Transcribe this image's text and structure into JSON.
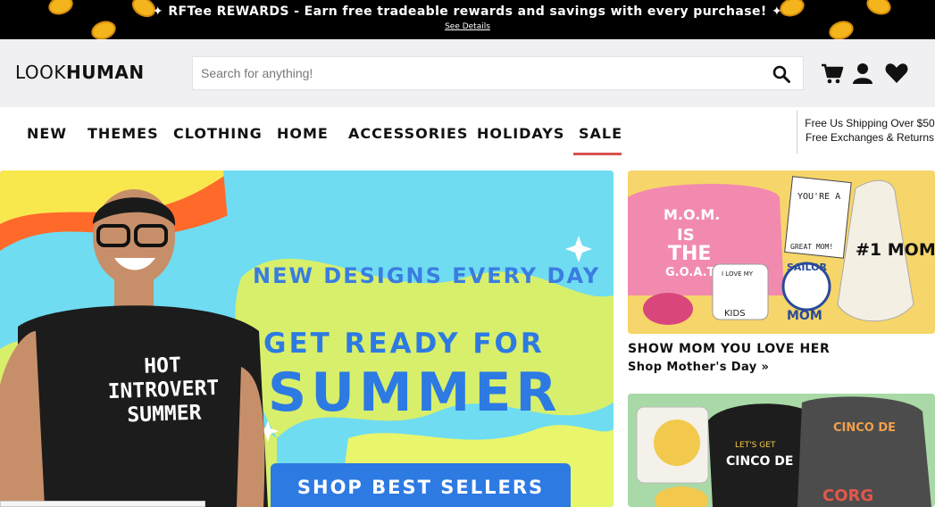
{
  "rewards": {
    "prefix": "✦ ",
    "brand": "RFTee REWARDS",
    "text": " - Earn free tradeable rewards and savings with every purchase! ✦",
    "link": "See Details"
  },
  "header": {
    "logo_light": "LOOK",
    "logo_bold": "HUMAN",
    "search_placeholder": "Search for anything!",
    "icons": [
      "search-icon",
      "cart-icon",
      "account-icon",
      "wishlist-heart-icon"
    ]
  },
  "nav": {
    "items": [
      "NEW",
      "THEMES",
      "CLOTHING",
      "HOME",
      "ACCESSORIES",
      "HOLIDAYS",
      "SALE"
    ],
    "active": "SALE",
    "shipping_line1": "Free Us Shipping Over $50",
    "shipping_line2": "Free Exchanges & Returns"
  },
  "hero": {
    "headline1": "NEW DESIGNS EVERY DAY",
    "headline2": "GET READY FOR",
    "headline3": "SUMMER",
    "cta": "SHOP BEST SELLERS",
    "shirt_lines": [
      "HOT",
      "INTROVERT",
      "SUMMER"
    ]
  },
  "promos": [
    {
      "title": "SHOW MOM YOU LOVE HER",
      "link": "Shop Mother's Day »",
      "art_text": [
        "M.O.M.",
        "IS",
        "THE",
        "G.O.A.T.",
        "YOU'RE A",
        "GREAT MOM!",
        "#1 MOM",
        "SAILOR",
        "MOM",
        "I LOVE MY",
        "KIDS"
      ]
    },
    {
      "art_text": [
        "CINCO DE",
        "CORG",
        "LET'S GET",
        "CINCO DE"
      ]
    }
  ],
  "colors": {
    "accent_red": "#d9534f",
    "hero_blue": "#2d7ae3",
    "hero_bg": "#6fdcf1",
    "banner_bg": "#000000"
  }
}
